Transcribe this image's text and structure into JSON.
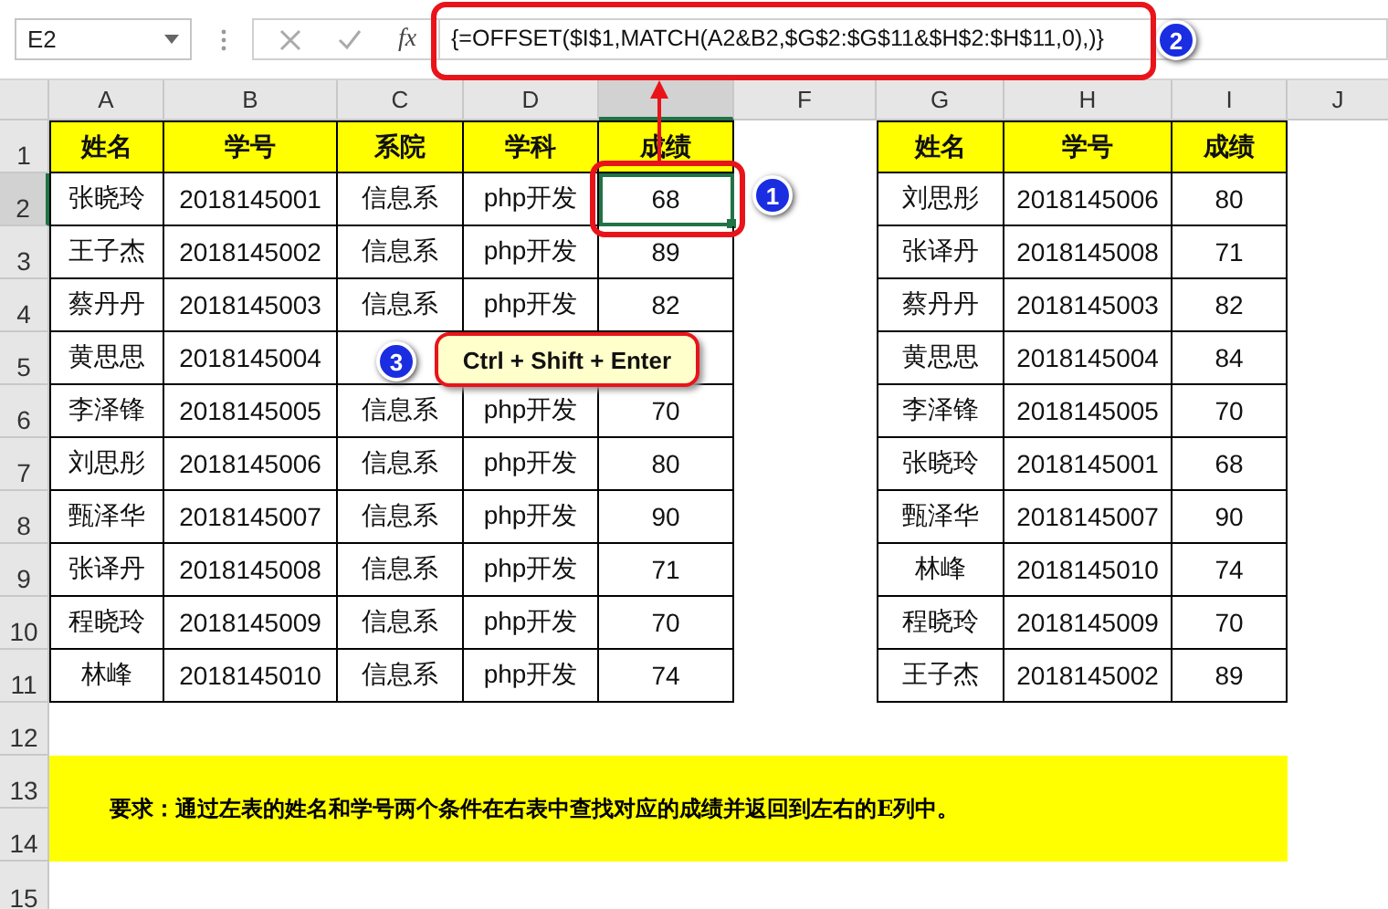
{
  "name_box": "E2",
  "formula_bar": {
    "fx": "fx",
    "formula": "{=OFFSET($I$1,MATCH(A2&B2,$G$2:$G$11&$H$2:$H$11,0),)}"
  },
  "column_headers": [
    {
      "label": "A",
      "selected": false
    },
    {
      "label": "B",
      "selected": false
    },
    {
      "label": "C",
      "selected": false
    },
    {
      "label": "D",
      "selected": false
    },
    {
      "selected": true
    },
    {
      "label": "F",
      "selected": false
    },
    {
      "label": "G",
      "selected": false
    },
    {
      "label": "H",
      "selected": false
    },
    {
      "label": "I",
      "selected": false
    },
    {
      "label": "J",
      "selected": false
    }
  ],
  "row_headers": [
    {
      "label": "1",
      "selected": false
    },
    {
      "label": "2",
      "selected": true
    },
    {
      "label": "3",
      "selected": false
    },
    {
      "label": "4",
      "selected": false
    },
    {
      "label": "5",
      "selected": false
    },
    {
      "label": "6",
      "selected": false
    },
    {
      "label": "7",
      "selected": false
    },
    {
      "label": "8",
      "selected": false
    },
    {
      "label": "9",
      "selected": false
    },
    {
      "label": "10",
      "selected": false
    },
    {
      "label": "11",
      "selected": false
    },
    {
      "label": "12",
      "selected": false
    },
    {
      "label": "13",
      "selected": false
    },
    {
      "label": "14",
      "selected": false
    },
    {
      "label": "15",
      "selected": false
    }
  ],
  "left_table": {
    "columns": [
      "姓名",
      "学号",
      "系院",
      "学科",
      "成绩"
    ],
    "rows": [
      [
        "张晓玲",
        "2018145001",
        "信息系",
        "php开发",
        "68"
      ],
      [
        "王子杰",
        "2018145002",
        "信息系",
        "php开发",
        "89"
      ],
      [
        "蔡丹丹",
        "2018145003",
        "信息系",
        "php开发",
        "82"
      ],
      [
        "黄思思",
        "2018145004",
        null,
        null,
        null
      ],
      [
        "李泽锋",
        "2018145005",
        "信息系",
        "php开发",
        "70"
      ],
      [
        "刘思彤",
        "2018145006",
        "信息系",
        "php开发",
        "80"
      ],
      [
        "甄泽华",
        "2018145007",
        "信息系",
        "php开发",
        "90"
      ],
      [
        "张译丹",
        "2018145008",
        "信息系",
        "php开发",
        "71"
      ],
      [
        "程晓玲",
        "2018145009",
        "信息系",
        "php开发",
        "70"
      ],
      [
        "林峰",
        "2018145010",
        "信息系",
        "php开发",
        "74"
      ]
    ]
  },
  "right_table": {
    "columns": [
      "姓名",
      "学号",
      "成绩"
    ],
    "rows": [
      [
        "刘思彤",
        "2018145006",
        "80"
      ],
      [
        "张译丹",
        "2018145008",
        "71"
      ],
      [
        "蔡丹丹",
        "2018145003",
        "82"
      ],
      [
        "黄思思",
        "2018145004",
        "84"
      ],
      [
        "李泽锋",
        "2018145005",
        "70"
      ],
      [
        "张晓玲",
        "2018145001",
        "68"
      ],
      [
        "甄泽华",
        "2018145007",
        "90"
      ],
      [
        "林峰",
        "2018145010",
        "74"
      ],
      [
        "程晓玲",
        "2018145009",
        "70"
      ],
      [
        "王子杰",
        "2018145002",
        "89"
      ]
    ]
  },
  "note": "要求：通过左表的姓名和学号两个条件在右表中查找对应的成绩并返回到左右的E列中。",
  "annotations": {
    "badges": [
      "1",
      "2",
      "3"
    ],
    "callout": "Ctrl + Shift + Enter"
  }
}
